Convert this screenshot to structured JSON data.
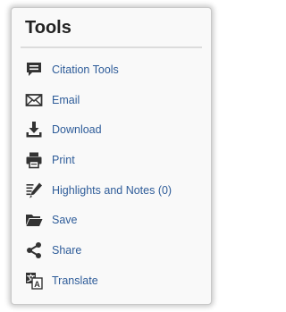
{
  "panel": {
    "title": "Tools",
    "items": [
      {
        "label": "Citation Tools",
        "icon": "citation-icon"
      },
      {
        "label": "Email",
        "icon": "email-icon"
      },
      {
        "label": "Download",
        "icon": "download-icon"
      },
      {
        "label": "Print",
        "icon": "print-icon"
      },
      {
        "label": "Highlights and Notes (0)",
        "icon": "highlight-notes-icon"
      },
      {
        "label": "Save",
        "icon": "folder-icon"
      },
      {
        "label": "Share",
        "icon": "share-icon"
      },
      {
        "label": "Translate",
        "icon": "translate-icon"
      }
    ]
  },
  "colors": {
    "link": "#2e5c99",
    "icon": "#333333",
    "title": "#222222",
    "panel_bg": "#f9f9f9"
  }
}
